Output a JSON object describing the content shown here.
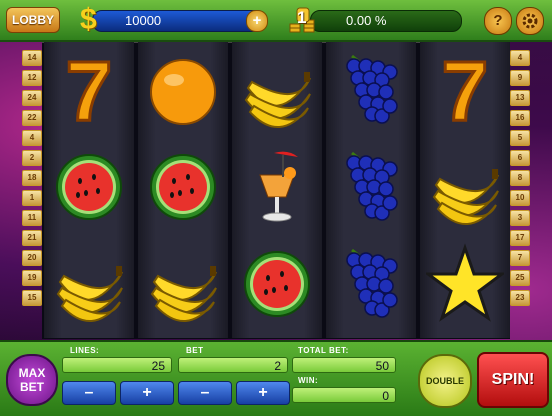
{
  "topbar": {
    "lobby_label": "LOBBY",
    "currency_icon": "$",
    "balance": "10000",
    "add_coins_label": "+",
    "level": "1",
    "progress_text": "0.00 %",
    "progress_fraction": 0.0,
    "help_label": "?",
    "settings_icon": "gear-icon"
  },
  "left_lines": [
    "14",
    "12",
    "24",
    "22",
    "4",
    "2",
    "18",
    "1",
    "11",
    "21",
    "20",
    "19",
    "15"
  ],
  "right_lines": [
    "4",
    "9",
    "13",
    "16",
    "5",
    "6",
    "8",
    "10",
    "3",
    "17",
    "7",
    "25",
    "23"
  ],
  "reels": [
    [
      "seven",
      "watermelon",
      "banana"
    ],
    [
      "orange",
      "watermelon",
      "banana"
    ],
    [
      "banana",
      "cocktail",
      "watermelon"
    ],
    [
      "grapes",
      "grapes",
      "grapes"
    ],
    [
      "seven",
      "banana",
      "star"
    ]
  ],
  "symbol_labels": {
    "seven": "7"
  },
  "controls": {
    "max_bet_label": "MAX BET",
    "lines_label": "LINES:",
    "lines_value": "25",
    "bet_label": "BET",
    "bet_value": "2",
    "total_bet_label": "TOTAL BET:",
    "total_bet_value": "50",
    "win_label": "WIN:",
    "win_value": "0",
    "minus_label": "–",
    "plus_label": "+",
    "double_label": "DOUBLE",
    "spin_label": "SPIN!"
  },
  "colors": {
    "green_bar": "#3d9a22",
    "spin_red": "#d81a1a",
    "max_bet_purple": "#8a1fa8",
    "gold": "#f7d01c"
  }
}
